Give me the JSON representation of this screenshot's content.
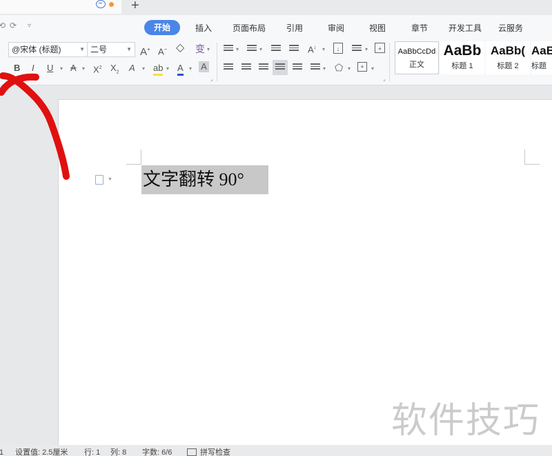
{
  "colors": {
    "accent": "#4a86e8",
    "annotation": "#e01010",
    "selection": "#c8c8c8",
    "watermark": "#a0a0a0"
  },
  "ribbon": {
    "tabs": [
      "开始",
      "插入",
      "页面布局",
      "引用",
      "审阅",
      "视图",
      "章节",
      "开发工具",
      "云服务"
    ],
    "active_tab": "开始",
    "font_name": "@宋体 (标题)",
    "font_size": "二号",
    "styles": [
      {
        "sample": "AaBbCcDd",
        "name": "正文"
      },
      {
        "sample": "AaBb",
        "name": "标题 1"
      },
      {
        "sample": "AaBb(",
        "name": "标题 2"
      },
      {
        "sample": "AaB",
        "name": "标题"
      }
    ]
  },
  "document": {
    "text": "文字翻转 90°"
  },
  "statusbar": {
    "setting": "设置值: 2.5厘米",
    "row": "行: 1",
    "col": "列: 8",
    "wordcount": "字数: 6/6",
    "spellcheck": "拼写检查"
  },
  "watermark": "软件技巧"
}
